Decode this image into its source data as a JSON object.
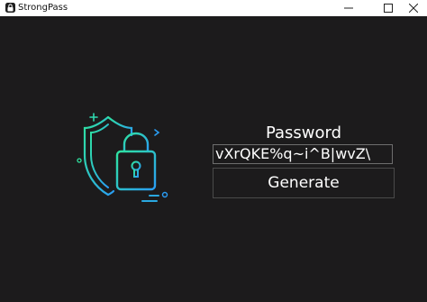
{
  "window": {
    "title": "StrongPass",
    "controls": {
      "minimize": "minimize-icon",
      "maximize": "maximize-icon",
      "close": "close-icon"
    }
  },
  "main": {
    "password_label": "Password",
    "password_value": "vXrQKE%q~i^B|wvZ\\",
    "generate_label": "Generate"
  },
  "colors": {
    "background": "#1c1b1c",
    "titlebar": "#ffffff",
    "text": "#ffffff",
    "icon_gradient_start": "#2fe3a0",
    "icon_gradient_end": "#2a9df4"
  }
}
